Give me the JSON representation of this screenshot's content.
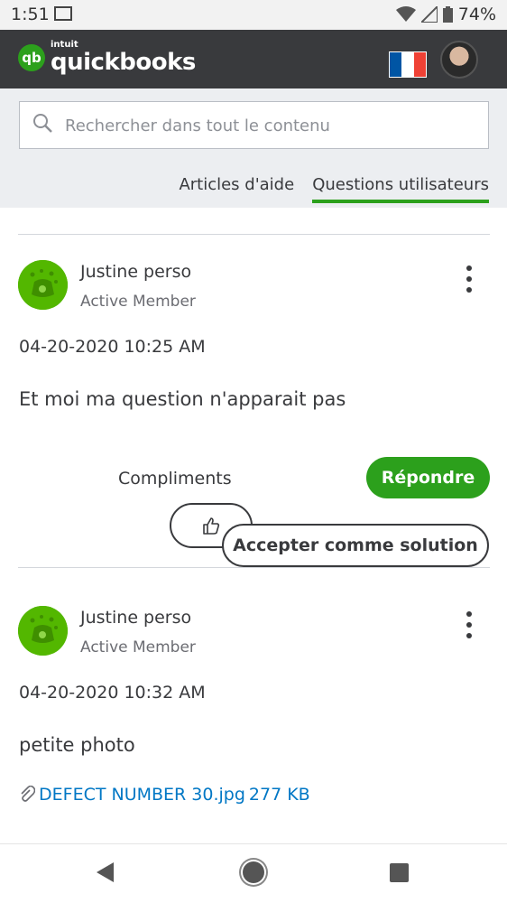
{
  "status_bar": {
    "time": "1:51",
    "battery": "74%",
    "icons": [
      "gmail-icon",
      "wifi-icon",
      "signal-icon",
      "battery-icon"
    ]
  },
  "header": {
    "logo_small": "intuit",
    "logo_main": "quickbooks",
    "logo_mark": "qb",
    "flag_colors": [
      "#0055a4",
      "#ffffff",
      "#ef4135"
    ]
  },
  "search": {
    "placeholder": "Rechercher dans tout le contenu"
  },
  "tabs": [
    {
      "label": "Articles d'aide",
      "active": false
    },
    {
      "label": "Questions utilisateurs",
      "active": true
    }
  ],
  "posts": [
    {
      "author": "Justine perso",
      "rank": "Active Member",
      "date": "04-20-2020 10:25 AM",
      "body": "Et moi ma question n'apparait pas",
      "compliments_label": "Compliments",
      "reply_label": "Répondre",
      "accept_label": "Accepter comme solution"
    },
    {
      "author": "Justine perso",
      "rank": "Active Member",
      "date": "04-20-2020 10:32 AM",
      "body": "petite photo",
      "attachment": {
        "name": "DEFECT NUMBER 30.jpg",
        "size": "277 KB"
      }
    }
  ],
  "colors": {
    "brand_green": "#2ca01c",
    "header_bg": "#393a3d",
    "link_blue": "#0077c5"
  }
}
